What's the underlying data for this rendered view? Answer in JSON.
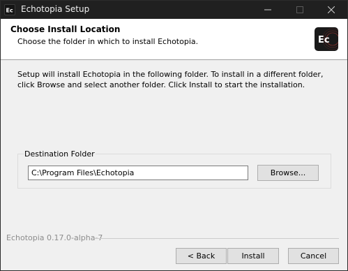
{
  "window": {
    "title": "Echotopia Setup",
    "app_icon_text": "Ec"
  },
  "header": {
    "title": "Choose Install Location",
    "subtitle": "Choose the folder in which to install Echotopia.",
    "logo_text": "Ec"
  },
  "body": {
    "intro": "Setup will install Echotopia in the following folder. To install in a different folder, click Browse and select another folder. Click Install to start the installation."
  },
  "destination": {
    "legend": "Destination Folder",
    "path": "C:\\Program Files\\Echotopia",
    "browse_label": "Browse..."
  },
  "footer": {
    "branding": "Echotopia 0.17.0-alpha-7",
    "back_label": "< Back",
    "install_label": "Install",
    "cancel_label": "Cancel"
  },
  "icons": {
    "minimize": "minimize-icon",
    "maximize": "maximize-icon",
    "close": "close-icon"
  },
  "colors": {
    "titlebar": "#202020",
    "dialog_bg": "#f0f0f0",
    "header_bg": "#ffffff",
    "logo_bg": "#1a1a1a",
    "logo_accent": "#e3413b"
  }
}
